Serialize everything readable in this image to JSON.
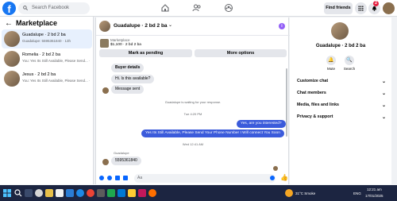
{
  "topbar": {
    "logo_letter": "f",
    "search_placeholder": "Search Facebook",
    "find_friends": "Find friends",
    "notification_count": "2"
  },
  "sidebar": {
    "title": "Marketplace",
    "conversations": [
      {
        "name": "Guadalupe · 2 bd 2 ba",
        "preview": "Guadalupe: 5595361840 · 13h",
        "active": true
      },
      {
        "name": "Romelia · 2 bd 2 ba",
        "preview": "You: Yes Its Still Available, Please Send... · 1d"
      },
      {
        "name": "Jesus · 2 bd 2 ba",
        "preview": "You: Yes Its Still Available, Please Send... · 2d"
      }
    ]
  },
  "chat": {
    "title": "Guadalupe · 2 bd 2 ba",
    "listing_label": "Marketplace",
    "listing_price": "$1,100 · 2 bd 2 ba",
    "mark_pending": "Mark as pending",
    "more_options": "More options",
    "buyer_details": "Buyer details",
    "msg_available": "Hi. Is this available?",
    "msg_sent": "Message sent",
    "waiting_note": "Guadalupe is waiting for your response.",
    "time_1": "Tue 4:20 PM",
    "out_1": "Yes, are you interested?",
    "out_2": "Yes Its Still Available, Please Send Your Phone Number I Will connect You Soon",
    "time_2": "Wed 12:41 AM",
    "sender_name": "Guadalupe",
    "in_phone": "5595361840",
    "composer_placeholder": "Aa"
  },
  "profile": {
    "name": "Guadalupe · 2 bd 2 ba",
    "mute": "Mute",
    "search": "Search",
    "rows": [
      "Customize chat",
      "Chat members",
      "Media, files and links",
      "Privacy & support"
    ]
  },
  "taskbar": {
    "search": "Search",
    "weather": "31°C Smoke",
    "lang": "ENG",
    "time": "12:21 am",
    "date": "17/01/2025"
  },
  "colors": {
    "accent": "#1877f2",
    "outgoing_bubble": "#3b5bdb",
    "taskbar": "#1c2541"
  }
}
